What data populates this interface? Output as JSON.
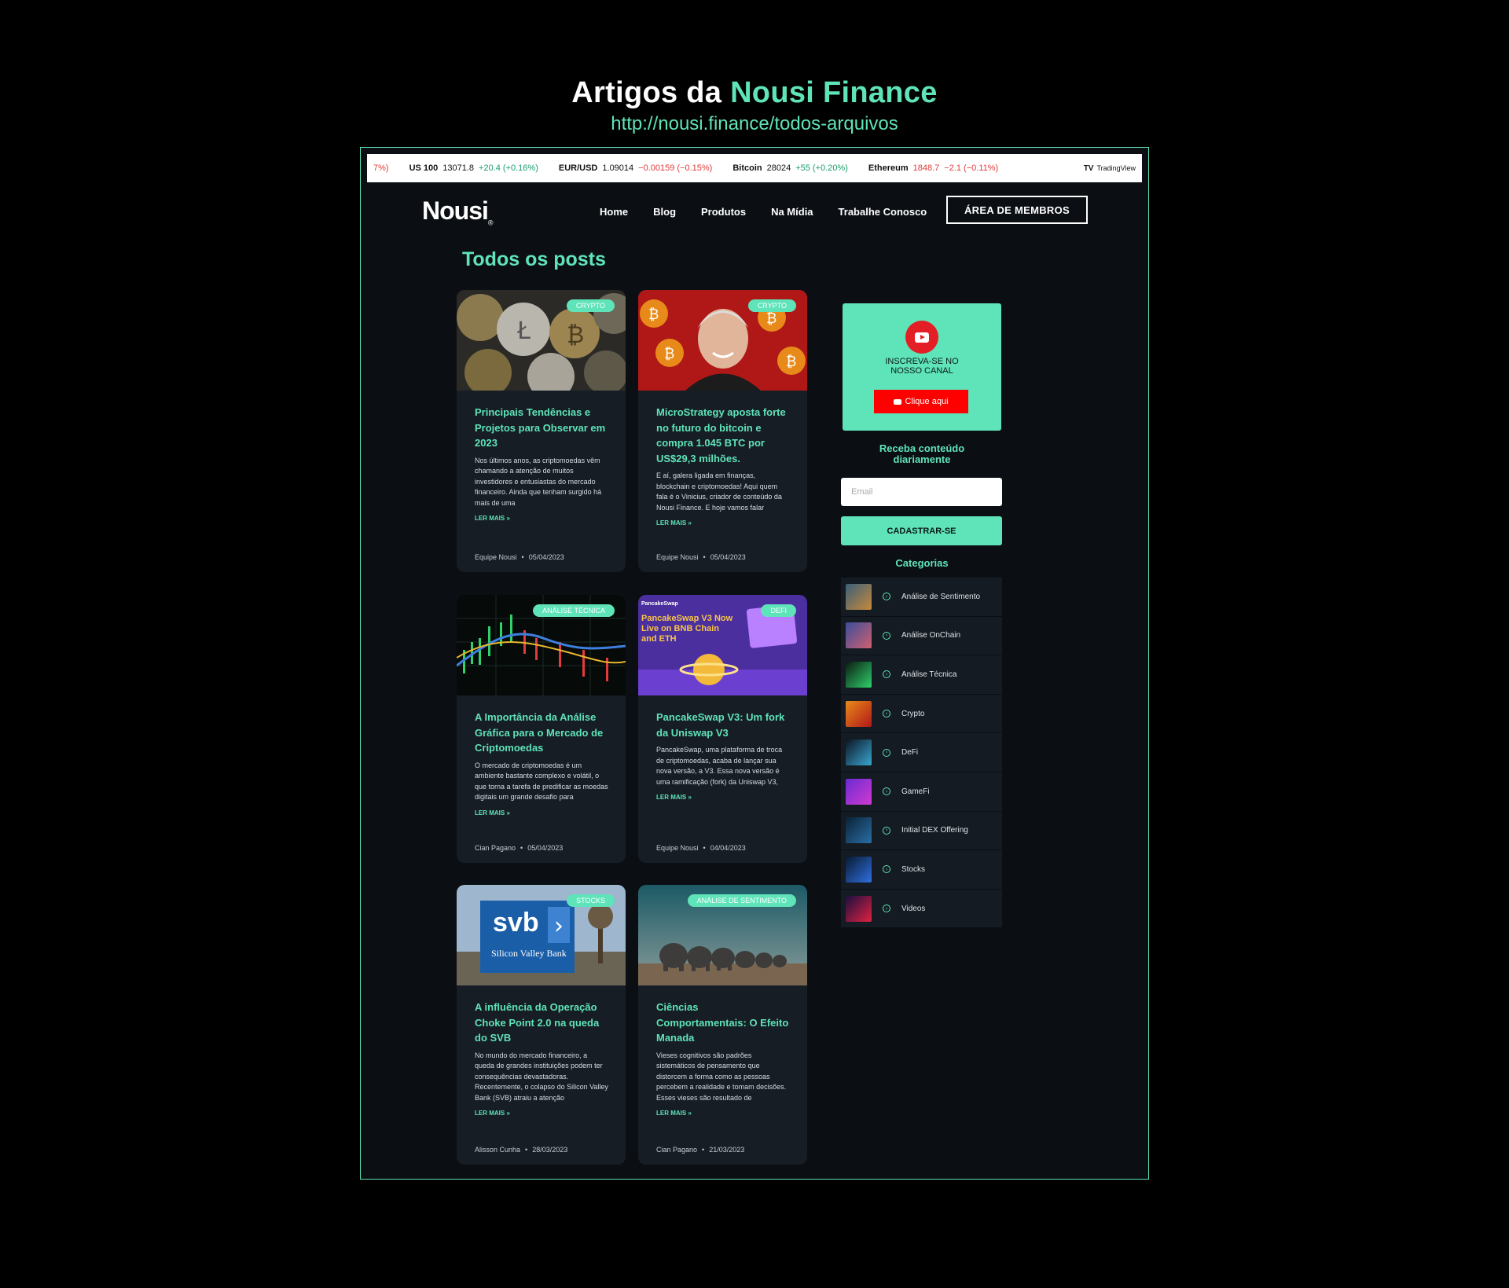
{
  "heading": {
    "title_plain": "Artigos da",
    "title_accent": "Nousi Finance",
    "url": "http://nousi.finance/todos-arquivos"
  },
  "ticker": {
    "items": [
      {
        "symbol": "7%)",
        "price": "",
        "change": "",
        "dir": "neg"
      },
      {
        "symbol": "US 100",
        "price": "13071.8",
        "change": "+20.4 (+0.16%)",
        "dir": "pos"
      },
      {
        "symbol": "EUR/USD",
        "price": "1.09014",
        "change": "−0.00159 (−0.15%)",
        "dir": "neg"
      },
      {
        "symbol": "Bitcoin",
        "price": "28024",
        "change": "+55 (+0.20%)",
        "dir": "pos"
      },
      {
        "symbol": "Ethereum",
        "price": "1848.7",
        "change": "−2.1 (−0.11%)",
        "dir": "neg"
      }
    ],
    "brand": "TradingView"
  },
  "nav": {
    "logo": "Nousi",
    "logo_mark": "®",
    "items": [
      "Home",
      "Blog",
      "Produtos",
      "Na Mídia",
      "Trabalhe Conosco"
    ],
    "members": "ÁREA DE MEMBROS"
  },
  "page_title": "Todos os posts",
  "posts": [
    {
      "tag": "Crypto",
      "title": "Principais Tendências e Projetos para Observar em 2023",
      "excerpt": "Nos últimos anos, as criptomoedas vêm chamando a atenção de muitos investidores e entusiastas do mercado financeiro. Ainda que tenham surgido há mais de uma",
      "more": "LER MAIS »",
      "author": "Equipe Nousi",
      "date": "05/04/2023"
    },
    {
      "tag": "Crypto",
      "title": "MicroStrategy aposta forte no futuro do bitcoin e compra 1.045 BTC por US$29,3 milhões.",
      "excerpt": "E aí, galera ligada em finanças, blockchain e criptomoedas! Aqui quem fala é o Vinicius, criador de conteúdo da Nousi Finance. E hoje vamos falar",
      "more": "LER MAIS »",
      "author": "Equipe Nousi",
      "date": "05/04/2023"
    },
    {
      "tag": "Análise Técnica",
      "title": "A Importância da Análise Gráfica para o Mercado de Criptomoedas",
      "excerpt": "O mercado de criptomoedas é um ambiente bastante complexo e volátil, o que torna a tarefa de predificar as moedas digitais um grande desafio para",
      "more": "LER MAIS »",
      "author": "Cian Pagano",
      "date": "05/04/2023"
    },
    {
      "tag": "DeFi",
      "title": "PancakeSwap V3: Um fork da Uniswap V3",
      "excerpt": "PancakeSwap, uma plataforma de troca de criptomoedas, acaba de lançar sua nova versão, a V3. Essa nova versão é uma ramificação (fork) da Uniswap V3,",
      "more": "LER MAIS »",
      "author": "Equipe Nousi",
      "date": "04/04/2023",
      "image_text": {
        "brand": "PancakeSwap",
        "headline": "PancakeSwap V3 Now Live on BNB Chain and ETH"
      }
    },
    {
      "tag": "Stocks",
      "title": "A influência da Operação Choke Point 2.0 na queda do SVB",
      "excerpt": "No mundo do mercado financeiro, a queda de grandes instituições podem ter consequências devastadoras. Recentemente, o colapso do Silicon Valley Bank (SVB) atraiu a atenção",
      "more": "LER MAIS »",
      "author": "Alisson Cunha",
      "date": "28/03/2023",
      "image_text": {
        "logo": "svb",
        "name": "Silicon Valley Bank"
      }
    },
    {
      "tag": "Análise de Sentimento",
      "title": "Ciências Comportamentais: O Efeito Manada",
      "excerpt": "Vieses cognitivos são padrões sistemáticos de pensamento que distorcem a forma como as pessoas percebem a realidade e tomam decisões. Esses vieses são resultado de",
      "more": "LER MAIS »",
      "author": "Cian Pagano",
      "date": "21/03/2023"
    }
  ],
  "sidebar": {
    "youtube": {
      "line1": "INSCREVA-SE NO",
      "line2": "NOSSO CANAL",
      "button": "Clique aqui"
    },
    "subscribe_title_1": "Receba conteúdo",
    "subscribe_title_2": "diariamente",
    "email_placeholder": "Email",
    "signup": "CADASTRAR-SE",
    "categories_title": "Categorias",
    "categories": [
      "Análise de Sentimento",
      "Análise OnChain",
      "Análise Técnica",
      "Crypto",
      "DeFi",
      "GameFi",
      "Initial DEX Offering",
      "Stocks",
      "Videos"
    ]
  },
  "colors": {
    "accent": "#5fe3b8",
    "background": "#0b0f14",
    "card": "#161d25",
    "youtube_red": "#ff0000"
  }
}
